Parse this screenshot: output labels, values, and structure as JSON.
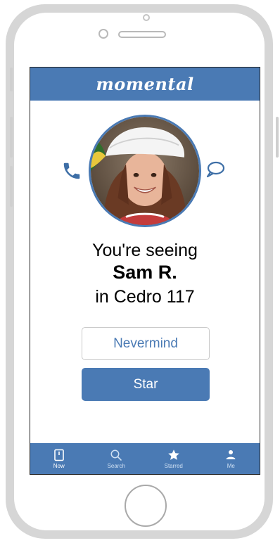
{
  "colors": {
    "brand": "#4a7ab4",
    "frame": "#d6d6d6"
  },
  "app": {
    "title": "momental"
  },
  "contact": {
    "line1": "You're seeing",
    "name": "Sam R.",
    "location": "in Cedro 117"
  },
  "actions": {
    "nevermind_label": "Nevermind",
    "star_label": "Star"
  },
  "icons": {
    "call": "phone-icon",
    "message": "chat-bubble-icon"
  },
  "tabs": [
    {
      "label": "Now",
      "icon": "now-icon",
      "active": true
    },
    {
      "label": "Search",
      "icon": "search-icon",
      "active": false
    },
    {
      "label": "Starred",
      "icon": "star-icon",
      "active": false
    },
    {
      "label": "Me",
      "icon": "person-icon",
      "active": false
    }
  ]
}
